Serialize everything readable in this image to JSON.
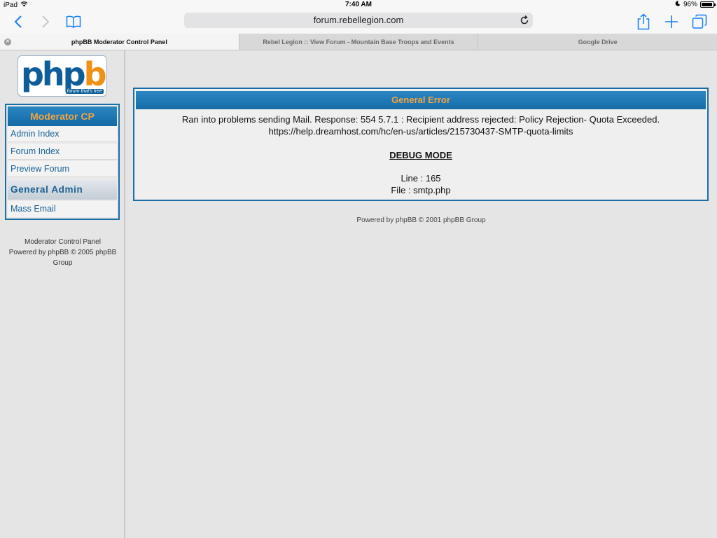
{
  "status_bar": {
    "device": "iPad",
    "time": "7:40 AM",
    "battery": "96%",
    "battery_level": 0.96
  },
  "browser": {
    "url": "forum.rebellegion.com",
    "icons": [
      "back-icon",
      "forward-icon",
      "bookmarks-icon",
      "reload-icon",
      "share-icon",
      "new-tab-icon",
      "tabs-icon"
    ],
    "tabs": [
      {
        "label": "phpBB Moderator Control Panel",
        "active": true
      },
      {
        "label": "Rebel Legion :: View Forum - Mountain Base Troops and Events",
        "active": false
      },
      {
        "label": "Google Drive",
        "active": false
      }
    ]
  },
  "sidebar": {
    "logo": {
      "php": "php",
      "bb": "bb",
      "tagline": "forum that's free"
    },
    "panel_title": "Moderator CP",
    "items": [
      {
        "label": "Admin Index"
      },
      {
        "label": "Forum Index"
      },
      {
        "label": "Preview Forum"
      }
    ],
    "category": "General Admin",
    "category_items": [
      {
        "label": "Mass Email"
      }
    ],
    "footer": {
      "line1": "Moderator Control Panel",
      "line2": "Powered by phpBB © 2005 phpBB",
      "line3": "Group"
    }
  },
  "error": {
    "title": "General Error",
    "message_line1": "Ran into problems sending Mail. Response: 554 5.7.1 : Recipient address rejected: Policy Rejection- Quota Exceeded.",
    "message_line2": "https://help.dreamhost.com/hc/en-us/articles/215730437-SMTP-quota-limits",
    "debug_label": "DEBUG MODE",
    "line_info": "Line : 165",
    "file_info": "File : smtp.php"
  },
  "main_footer": "Powered by phpBB © 2001 phpBB Group",
  "colors": {
    "accent_blue": "#1b6da5",
    "header_orange": "#f1a33f",
    "link_blue": "#1a6295"
  }
}
